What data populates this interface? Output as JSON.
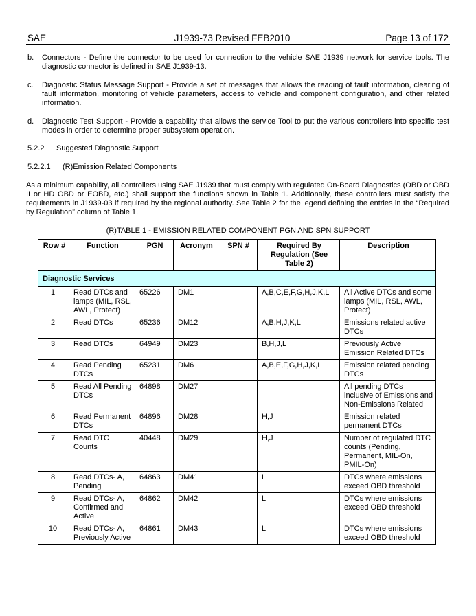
{
  "header": {
    "org": "SAE",
    "doc": "J1939-73 Revised FEB2010",
    "page": "Page 13 of 172"
  },
  "items": [
    {
      "marker": "b.",
      "text": "Connectors - Define the connector to be used for connection to the vehicle SAE J1939 network for service tools. The diagnostic connector is defined in SAE J1939-13."
    },
    {
      "marker": "c.",
      "text": "Diagnostic Status Message Support - Provide a set of messages that allows the reading of fault information, clearing of fault information, monitoring of vehicle parameters, access to vehicle and component configuration, and other related information."
    },
    {
      "marker": "d.",
      "text": "Diagnostic Test Support - Provide a capability that allows the service Tool to put the various controllers into specific test modes in order to determine proper subsystem operation."
    }
  ],
  "sections": [
    {
      "number": "5.2.2",
      "title": "Suggested Diagnostic Support"
    },
    {
      "number": "5.2.2.1",
      "title": "(R)Emission Related Components"
    }
  ],
  "intro_paragraph": "As a minimum capability, all controllers using SAE J1939 that must comply with regulated On-Board Diagnostics (OBD or OBD II or HD OBD or EOBD, etc.) shall support the functions shown in Table 1. Additionally, these controllers must satisfy the requirements in J1939-03 if required by the regional authority.  See Table 2 for the legend defining the entries in the “Required by Regulation” column of Table 1.",
  "table": {
    "caption": "(R)TABLE 1 -  EMISSION RELATED COMPONENT PGN AND SPN SUPPORT",
    "columns": [
      "Row #",
      "Function",
      "PGN",
      "Acronym",
      "SPN #",
      "Required By Regulation (See Table 2)",
      "Description"
    ],
    "group": "Diagnostic Services",
    "rows": [
      {
        "row": "1",
        "function": "Read DTCs and lamps (MIL, RSL, AWL, Protect)",
        "pgn": "65226",
        "acronym": "DM1",
        "spn": "",
        "required": "A,B,C,E,F,G,H,J,K,L",
        "description": "All Active DTCs and some lamps (MIL, RSL, AWL, Protect)"
      },
      {
        "row": "2",
        "function": "Read DTCs",
        "pgn": "65236",
        "acronym": "DM12",
        "spn": "",
        "required": "A,B,H,J,K,L",
        "description": "Emissions related active DTCs"
      },
      {
        "row": "3",
        "function": "Read DTCs",
        "pgn": "64949",
        "acronym": "DM23",
        "spn": "",
        "required": "B,H,J,L",
        "description": "Previously Active Emission Related DTCs"
      },
      {
        "row": "4",
        "function": "Read Pending DTCs",
        "pgn": "65231",
        "acronym": "DM6",
        "spn": "",
        "required": "A,B,E,F,G,H,J,K,L",
        "description": "Emission related pending DTCs"
      },
      {
        "row": "5",
        "function": "Read All Pending DTCs",
        "pgn": "64898",
        "acronym": "DM27",
        "spn": "",
        "required": "",
        "description": "All pending DTCs inclusive of Emissions and Non-Emissions Related"
      },
      {
        "row": "6",
        "function": "Read Permanent DTCs",
        "pgn": "64896",
        "acronym": "DM28",
        "spn": "",
        "required": "H,J",
        "description": "Emission related permanent DTCs"
      },
      {
        "row": "7",
        "function": "Read DTC Counts",
        "pgn": "40448",
        "acronym": "DM29",
        "spn": "",
        "required": "H,J",
        "description": "Number of regulated DTC counts (Pending, Permanent, MIL-On, PMIL-On)"
      },
      {
        "row": "8",
        "function": "Read DTCs- A, Pending",
        "pgn": "64863",
        "acronym": "DM41",
        "spn": "",
        "required": "L",
        "description": "DTCs where emissions exceed OBD threshold"
      },
      {
        "row": "9",
        "function": "Read DTCs- A, Confirmed and Active",
        "pgn": "64862",
        "acronym": "DM42",
        "spn": "",
        "required": "L",
        "description": "DTCs where emissions exceed OBD threshold"
      },
      {
        "row": "10",
        "function": "Read DTCs- A, Previously Active",
        "pgn": "64861",
        "acronym": "DM43",
        "spn": "",
        "required": "L",
        "description": "DTCs where emissions exceed OBD threshold"
      }
    ]
  }
}
